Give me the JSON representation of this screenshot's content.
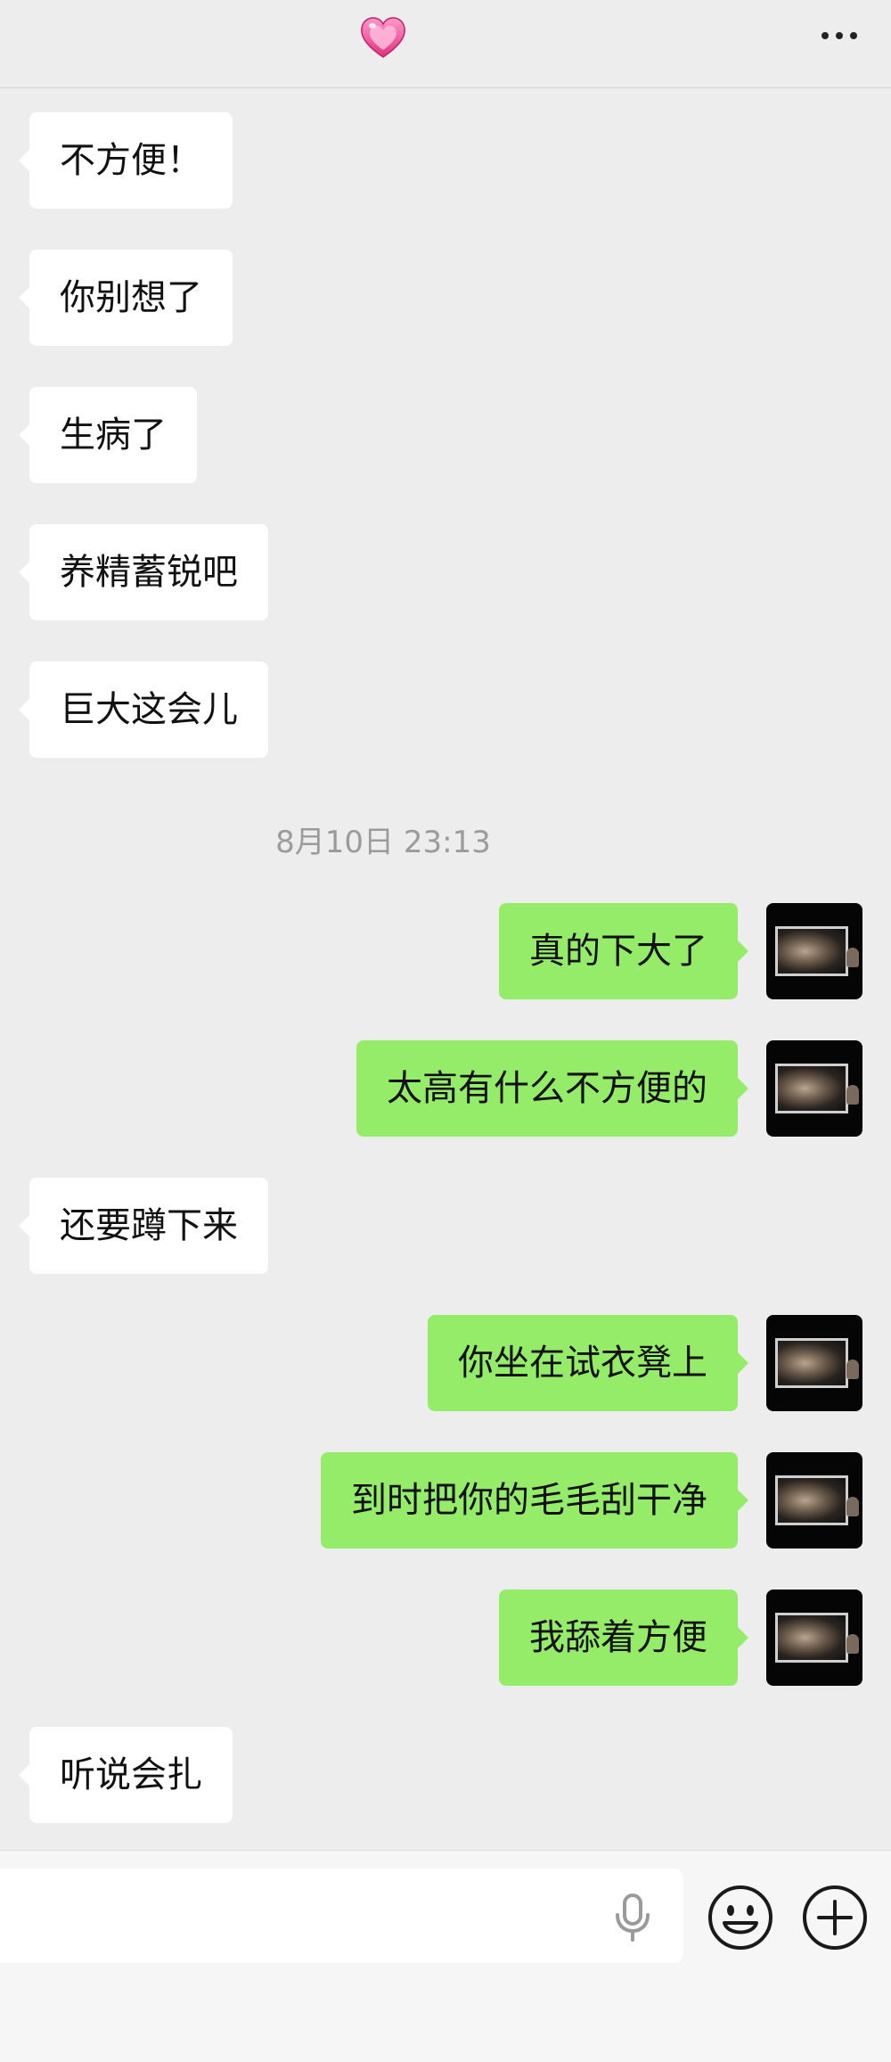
{
  "header": {
    "title_icon": "heart-icon",
    "more_icon": "more-options-icon"
  },
  "messages": [
    {
      "side": "left",
      "text": "不方便！"
    },
    {
      "side": "left",
      "text": "你别想了"
    },
    {
      "side": "left",
      "text": "生病了"
    },
    {
      "side": "left",
      "text": "养精蓄锐吧"
    },
    {
      "side": "left",
      "text": "巨大这会儿"
    },
    {
      "side": "right",
      "text": "真的下大了"
    },
    {
      "side": "right",
      "text": "太高有什么不方便的"
    },
    {
      "side": "left",
      "text": "还要蹲下来"
    },
    {
      "side": "right",
      "text": "你坐在试衣凳上"
    },
    {
      "side": "right",
      "text": "到时把你的毛毛刮干净"
    },
    {
      "side": "right",
      "text": "我舔着方便"
    },
    {
      "side": "left",
      "text": "听说会扎"
    }
  ],
  "timestamp": "8月10日 23:13",
  "input": {
    "value": "",
    "mic_icon": "microphone-icon",
    "emoji_icon": "emoji-icon",
    "plus_icon": "plus-icon"
  },
  "colors": {
    "background": "#ededed",
    "incoming_bubble": "#ffffff",
    "outgoing_bubble": "#95ec69"
  }
}
